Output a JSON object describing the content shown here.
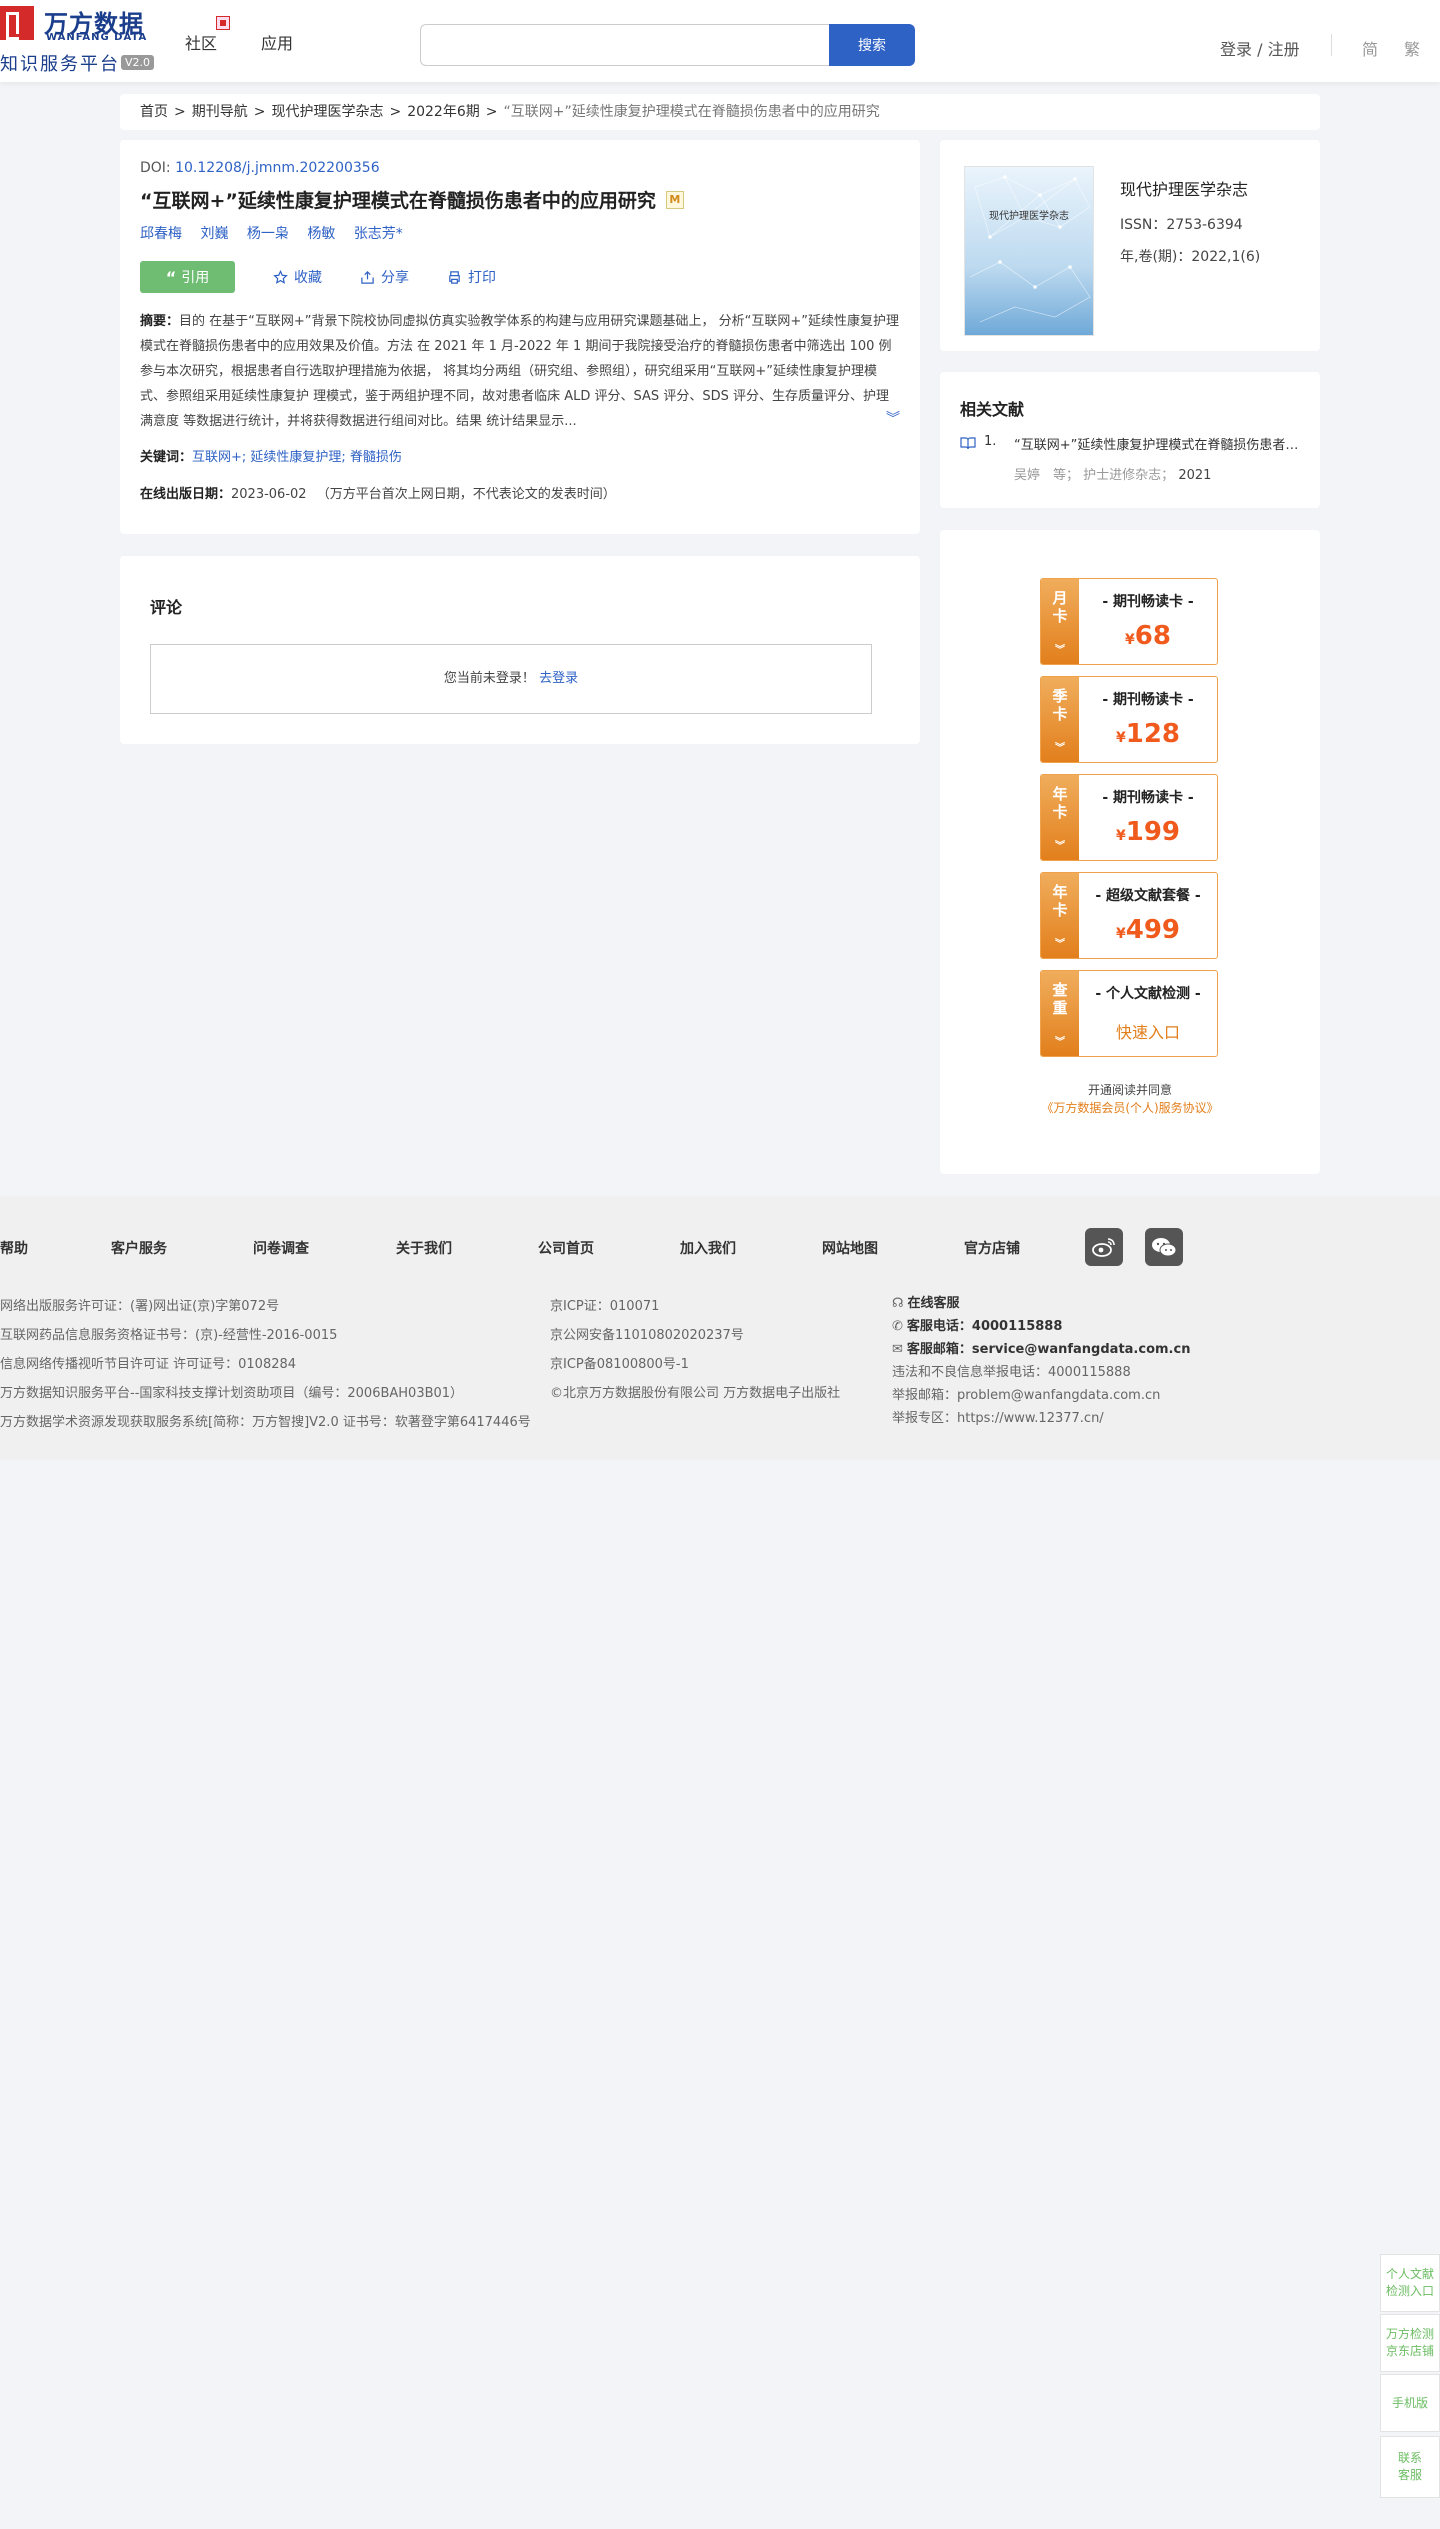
{
  "header": {
    "logo_cn": "万方数据",
    "logo_en": "WANFANG DATA",
    "platform": "知识服务平台",
    "version": "V2.0",
    "nav": {
      "community": "社区",
      "app": "应用"
    },
    "search": {
      "placeholder": "",
      "button": "搜索"
    },
    "login": "登录 / 注册",
    "lang_simplified": "简",
    "lang_traditional": "繁"
  },
  "breadcrumb": {
    "items": [
      "首页",
      "期刊导航",
      "现代护理医学杂志",
      "2022年6期"
    ],
    "current": "“互联网+”延续性康复护理模式在脊髓损伤患者中的应用研究",
    "separator": ">"
  },
  "article": {
    "doi_label": "DOI:",
    "doi": "10.12208/j.jmnm.202200356",
    "title": "“互联网+”延续性康复护理模式在脊髓损伤患者中的应用研究",
    "m_badge": "M",
    "authors": [
      "邱春梅",
      "刘巍",
      "杨一枭",
      "杨敏",
      "张志芳*"
    ],
    "actions": {
      "cite": "引用",
      "favorite": "收藏",
      "share": "分享",
      "print": "打印"
    },
    "abstract_label": "摘要：",
    "abstract": "目的 在基于“互联网+”背景下院校协同虚拟仿真实验教学体系的构建与应用研究课题基础上， 分析“互联网+”延续性康复护理模式在脊髓损伤患者中的应用效果及价值。方法 在 2021 年 1 月-2022 年 1 期间于我院接受治疗的脊髓损伤患者中筛选出 100 例参与本次研究，根据患者自行选取护理措施为依据， 将其均分两组（研究组、参照组），研究组采用“互联网+”延续性康复护理模式、参照组采用延续性康复护 理模式，鉴于两组护理不同，故对患者临床 ALD 评分、SAS 评分、SDS 评分、生存质量评分、护理满意度 等数据进行统计，并将获得数据进行组间对比。结果 统计结果显示...",
    "keywords_label": "关键词：",
    "keywords": "互联网+; 延续性康复护理; 脊髓损伤",
    "pubdate_label": "在线出版日期：",
    "pubdate": "2023-06-02",
    "pubdate_note": "（万方平台首次上网日期，不代表论文的发表时间）"
  },
  "comments": {
    "heading": "评论",
    "not_logged": "您当前未登录！",
    "login_link": "去登录"
  },
  "journal": {
    "cover_title": "现代护理医学杂志",
    "name": "现代护理医学杂志",
    "issn": "ISSN：2753-6394",
    "issue": "年,卷(期)：2022,1(6)"
  },
  "related": {
    "heading": "相关文献",
    "items": [
      {
        "num": "1.",
        "title": "“互联网+”延续性康复护理模式在脊髓损伤患者中的应用研究",
        "authors": "吴婷　等",
        "journal": "护士进修杂志",
        "year": "2021"
      }
    ]
  },
  "membership": {
    "cards": [
      {
        "tag": "月卡",
        "name": "- 期刊畅读卡 -",
        "currency": "¥",
        "price": "68"
      },
      {
        "tag": "季卡",
        "name": "- 期刊畅读卡 -",
        "currency": "¥",
        "price": "128"
      },
      {
        "tag": "年卡",
        "name": "- 期刊畅读卡 -",
        "currency": "¥",
        "price": "199"
      },
      {
        "tag": "年卡",
        "name": "- 超级文献套餐 -",
        "currency": "¥",
        "price": "499"
      },
      {
        "tag": "查重",
        "name": "- 个人文献检测 -",
        "entry": "快速入口"
      }
    ],
    "agree_text": "开通阅读并同意",
    "agree_link": "《万方数据会员(个人)服务协议》"
  },
  "footer": {
    "links": [
      "帮助",
      "客户服务",
      "问卷调查",
      "关于我们",
      "公司首页",
      "加入我们",
      "网站地图",
      "官方店铺"
    ],
    "col1": [
      "网络出版服务许可证：(署)网出证(京)字第072号",
      "互联网药品信息服务资格证书号：(京)-经营性-2016-0015",
      "信息网络传播视听节目许可证 许可证号：0108284",
      "万方数据知识服务平台--国家科技支撑计划资助项目（编号：2006BAH03B01）",
      "万方数据学术资源发现获取服务系统[简称：万方智搜]V2.0 证书号：软著登字第6417446号"
    ],
    "col2": [
      "京ICP证：010071",
      "京公网安备11010802020237号",
      "京ICP备08100800号-1",
      "©北京万方数据股份有限公司 万方数据电子出版社"
    ],
    "col3": {
      "online_service": "在线客服",
      "phone_label": "客服电话：",
      "phone": "4000115888",
      "email_label": "客服邮箱：",
      "email": "service@wanfangdata.com.cn",
      "report_phone": "违法和不良信息举报电话：4000115888",
      "report_email": "举报邮箱：problem@wanfangdata.com.cn",
      "report_zone": "举报专区：https://www.12377.cn/"
    }
  },
  "side": {
    "personal_check": "个人文献检测入口",
    "jd_store": "万方检测京东店铺",
    "mobile": "手机版",
    "contact": "联系客服"
  }
}
